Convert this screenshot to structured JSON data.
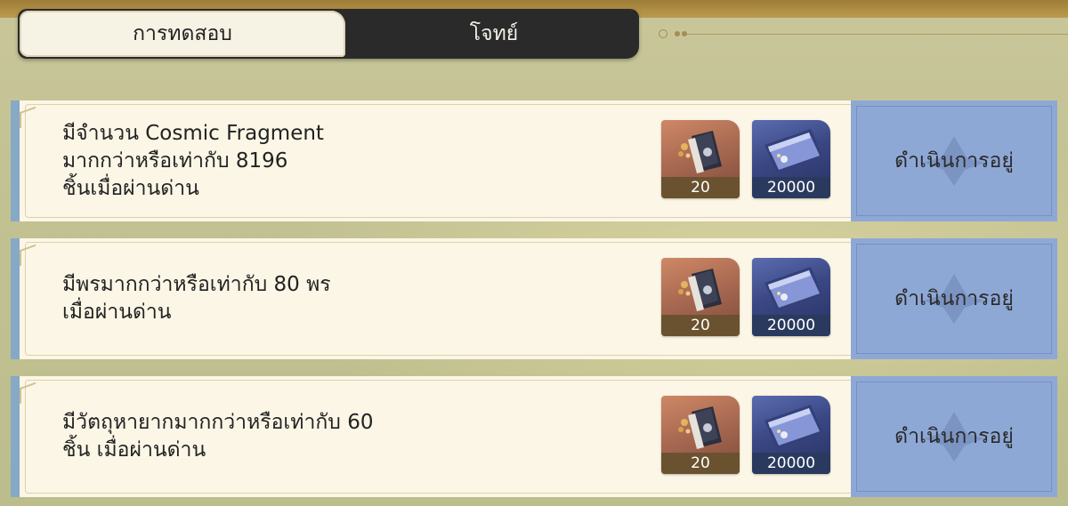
{
  "tabs": [
    {
      "label": "การทดสอบ",
      "active": true
    },
    {
      "label": "โจทย์",
      "active": false
    }
  ],
  "challenges": [
    {
      "description": "มีจำนวน Cosmic Fragment\nมากกว่าหรือเท่ากับ 8196\nชิ้นเมื่อผ่านด่าน",
      "rewards": [
        {
          "icon": "book-item-icon",
          "count": "20"
        },
        {
          "icon": "credit-card-item-icon",
          "count": "20000"
        }
      ],
      "status": "ดำเนินการอยู่"
    },
    {
      "description": "มีพรมากกว่าหรือเท่ากับ 80 พร\nเมื่อผ่านด่าน",
      "rewards": [
        {
          "icon": "book-item-icon",
          "count": "20"
        },
        {
          "icon": "credit-card-item-icon",
          "count": "20000"
        }
      ],
      "status": "ดำเนินการอยู่"
    },
    {
      "description": "มีวัตถุหายากมากกว่าหรือเท่ากับ 60\nชิ้น เมื่อผ่านด่าน",
      "rewards": [
        {
          "icon": "book-item-icon",
          "count": "20"
        },
        {
          "icon": "credit-card-item-icon",
          "count": "20000"
        }
      ],
      "status": "ดำเนินการอยู่"
    }
  ],
  "colors": {
    "status_bg": "#8ea8d6",
    "card_bg": "#fbf6e6",
    "tab_bar_bg": "#2a2a2a",
    "accent_border": "#86a9c6"
  }
}
